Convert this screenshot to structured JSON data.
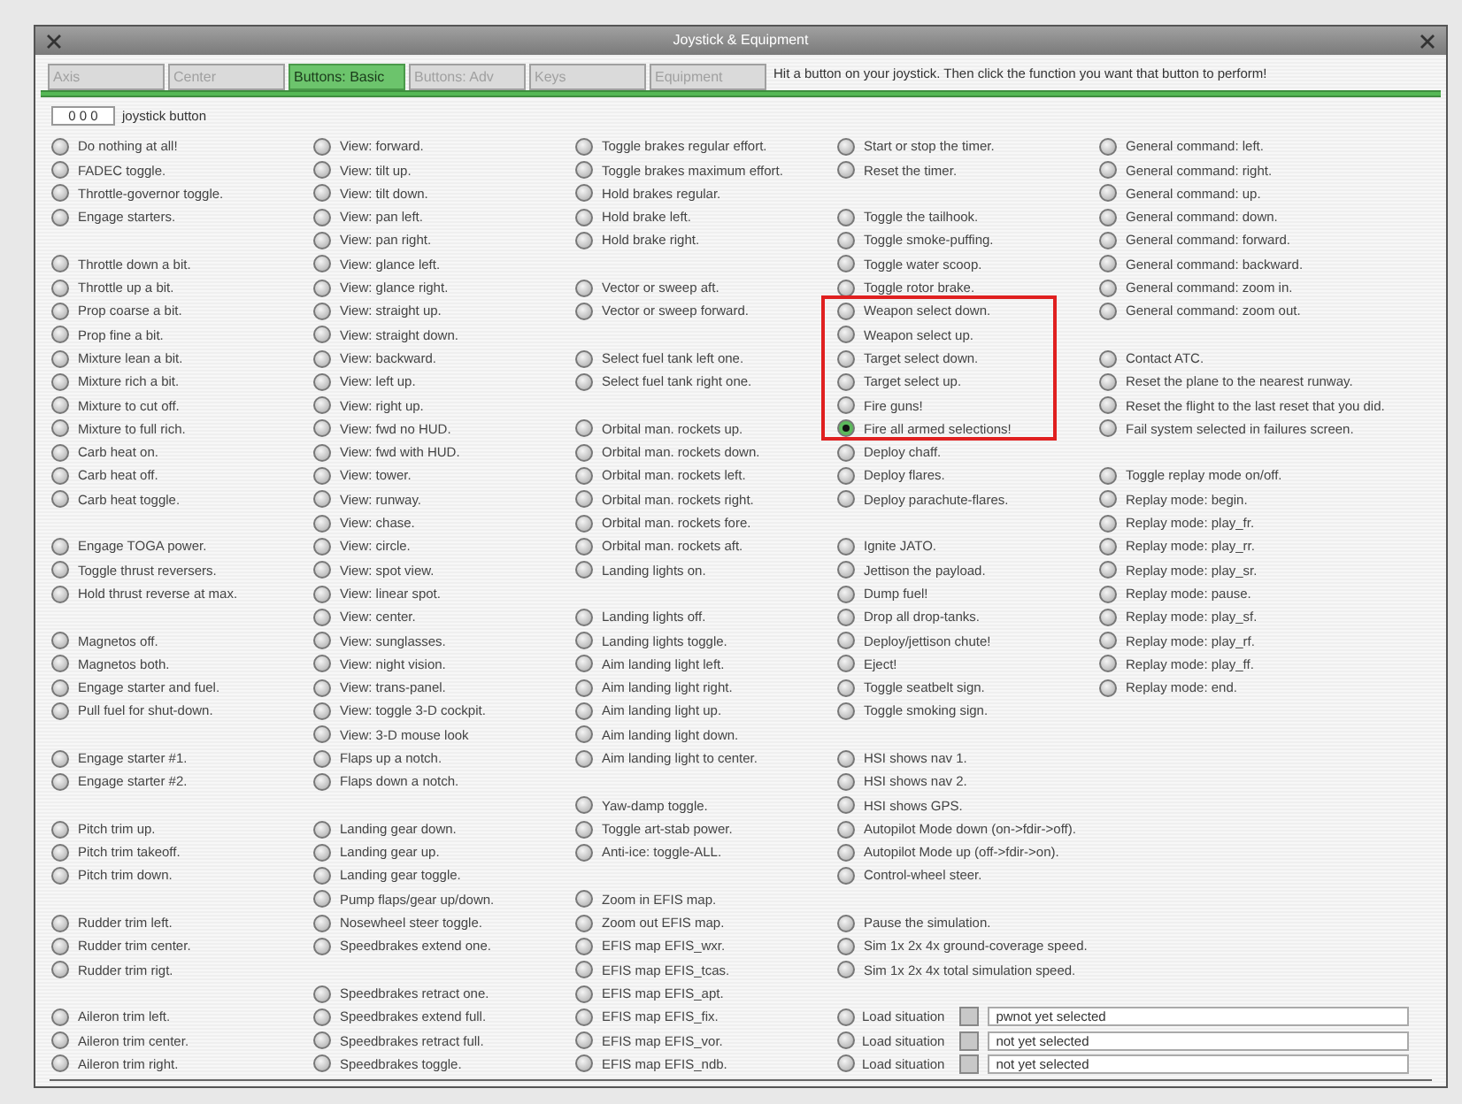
{
  "window": {
    "title": "Joystick & Equipment"
  },
  "tabs": [
    {
      "label": "Axis",
      "selected": false
    },
    {
      "label": "Center",
      "selected": false
    },
    {
      "label": "Buttons: Basic",
      "selected": true
    },
    {
      "label": "Buttons: Adv",
      "selected": false
    },
    {
      "label": "Keys",
      "selected": false
    },
    {
      "label": "Equipment",
      "selected": false
    }
  ],
  "hint": "Hit a button on your joystick. Then click the function you want that button to perform!",
  "joystick_button": {
    "value": "0 0 0",
    "label": "joystick button"
  },
  "columns": [
    {
      "groups": [
        {
          "items": [
            {
              "label": "Do nothing at all!",
              "selected": false
            },
            {
              "label": "FADEC toggle.",
              "selected": false
            },
            {
              "label": "Throttle-governor toggle.",
              "selected": false
            },
            {
              "label": "Engage starters.",
              "selected": false
            }
          ]
        },
        {
          "items": [
            {
              "label": "Throttle down a bit.",
              "selected": false
            },
            {
              "label": "Throttle up a bit.",
              "selected": false
            },
            {
              "label": "Prop coarse a bit.",
              "selected": false
            },
            {
              "label": "Prop fine a bit.",
              "selected": false
            },
            {
              "label": "Mixture lean a bit.",
              "selected": false
            },
            {
              "label": "Mixture rich a bit.",
              "selected": false
            },
            {
              "label": "Mixture to cut off.",
              "selected": false
            },
            {
              "label": "Mixture to full rich.",
              "selected": false
            },
            {
              "label": "Carb heat on.",
              "selected": false
            },
            {
              "label": "Carb heat off.",
              "selected": false
            },
            {
              "label": "Carb heat toggle.",
              "selected": false
            }
          ]
        },
        {
          "items": [
            {
              "label": "Engage TOGA power.",
              "selected": false
            },
            {
              "label": "Toggle thrust reversers.",
              "selected": false
            },
            {
              "label": "Hold thrust reverse at max.",
              "selected": false
            }
          ]
        },
        {
          "items": [
            {
              "label": "Magnetos off.",
              "selected": false
            },
            {
              "label": "Magnetos both.",
              "selected": false
            },
            {
              "label": "Engage starter and fuel.",
              "selected": false
            },
            {
              "label": "Pull fuel for shut-down.",
              "selected": false
            }
          ]
        },
        {
          "items": [
            {
              "label": "Engage starter #1.",
              "selected": false
            },
            {
              "label": "Engage starter #2.",
              "selected": false
            }
          ]
        },
        {
          "items": [
            {
              "label": "Pitch trim up.",
              "selected": false
            },
            {
              "label": "Pitch trim takeoff.",
              "selected": false
            },
            {
              "label": "Pitch trim down.",
              "selected": false
            }
          ]
        },
        {
          "items": [
            {
              "label": "Rudder trim left.",
              "selected": false
            },
            {
              "label": "Rudder trim center.",
              "selected": false
            },
            {
              "label": "Rudder trim rigt.",
              "selected": false
            }
          ]
        },
        {
          "items": [
            {
              "label": "Aileron trim left.",
              "selected": false
            },
            {
              "label": "Aileron trim center.",
              "selected": false
            },
            {
              "label": "Aileron trim right.",
              "selected": false
            }
          ]
        }
      ]
    },
    {
      "groups": [
        {
          "items": [
            {
              "label": "View: forward.",
              "selected": false
            },
            {
              "label": "View: tilt up.",
              "selected": false
            },
            {
              "label": "View: tilt down.",
              "selected": false
            },
            {
              "label": "View: pan left.",
              "selected": false
            },
            {
              "label": "View: pan right.",
              "selected": false
            },
            {
              "label": "View: glance left.",
              "selected": false
            },
            {
              "label": "View: glance right.",
              "selected": false
            },
            {
              "label": "View: straight up.",
              "selected": false
            },
            {
              "label": "View: straight down.",
              "selected": false
            },
            {
              "label": "View: backward.",
              "selected": false
            },
            {
              "label": "View: left up.",
              "selected": false
            },
            {
              "label": "View: right up.",
              "selected": false
            },
            {
              "label": "View: fwd no HUD.",
              "selected": false
            },
            {
              "label": "View: fwd with HUD.",
              "selected": false
            },
            {
              "label": "View: tower.",
              "selected": false
            },
            {
              "label": "View: runway.",
              "selected": false
            },
            {
              "label": "View: chase.",
              "selected": false
            },
            {
              "label": "View: circle.",
              "selected": false
            },
            {
              "label": "View: spot view.",
              "selected": false
            },
            {
              "label": "View: linear spot.",
              "selected": false
            },
            {
              "label": "View: center.",
              "selected": false
            },
            {
              "label": "View: sunglasses.",
              "selected": false
            },
            {
              "label": "View: night vision.",
              "selected": false
            },
            {
              "label": "View: trans-panel.",
              "selected": false
            },
            {
              "label": "View: toggle 3-D cockpit.",
              "selected": false
            },
            {
              "label": "View: 3-D mouse look",
              "selected": false
            },
            {
              "label": "Flaps up a notch.",
              "selected": false
            },
            {
              "label": "Flaps down a notch.",
              "selected": false
            }
          ]
        },
        {
          "items": [
            {
              "label": "Landing gear down.",
              "selected": false
            },
            {
              "label": "Landing gear up.",
              "selected": false
            },
            {
              "label": "Landing gear toggle.",
              "selected": false
            },
            {
              "label": "Pump flaps/gear up/down.",
              "selected": false
            },
            {
              "label": "Nosewheel steer toggle.",
              "selected": false
            },
            {
              "label": "Speedbrakes extend one.",
              "selected": false
            }
          ]
        },
        {
          "items": [
            {
              "label": "Speedbrakes retract one.",
              "selected": false
            },
            {
              "label": "Speedbrakes extend full.",
              "selected": false
            },
            {
              "label": "Speedbrakes retract full.",
              "selected": false
            },
            {
              "label": "Speedbrakes toggle.",
              "selected": false
            }
          ]
        }
      ]
    },
    {
      "groups": [
        {
          "items": [
            {
              "label": "Toggle brakes regular effort.",
              "selected": false
            },
            {
              "label": "Toggle brakes maximum effort.",
              "selected": false
            },
            {
              "label": "Hold brakes regular.",
              "selected": false
            },
            {
              "label": "Hold brake left.",
              "selected": false
            },
            {
              "label": "Hold brake right.",
              "selected": false
            }
          ]
        },
        {
          "items": [
            {
              "label": "Vector or sweep aft.",
              "selected": false
            },
            {
              "label": "Vector or sweep forward.",
              "selected": false
            }
          ]
        },
        {
          "items": [
            {
              "label": "Select fuel tank left one.",
              "selected": false
            },
            {
              "label": "Select fuel tank right one.",
              "selected": false
            }
          ]
        },
        {
          "items": [
            {
              "label": "Orbital man. rockets up.",
              "selected": false
            },
            {
              "label": "Orbital man. rockets down.",
              "selected": false
            },
            {
              "label": "Orbital man. rockets left.",
              "selected": false
            },
            {
              "label": "Orbital man. rockets right.",
              "selected": false
            },
            {
              "label": "Orbital man. rockets fore.",
              "selected": false
            },
            {
              "label": "Orbital man. rockets aft.",
              "selected": false
            },
            {
              "label": "Landing lights on.",
              "selected": false
            }
          ]
        },
        {
          "items": [
            {
              "label": "Landing lights off.",
              "selected": false
            },
            {
              "label": "Landing lights toggle.",
              "selected": false
            },
            {
              "label": "Aim landing light left.",
              "selected": false
            },
            {
              "label": "Aim landing light right.",
              "selected": false
            },
            {
              "label": "Aim landing light up.",
              "selected": false
            },
            {
              "label": "Aim landing light down.",
              "selected": false
            },
            {
              "label": "Aim landing light to center.",
              "selected": false
            }
          ]
        },
        {
          "items": [
            {
              "label": "Yaw-damp toggle.",
              "selected": false
            },
            {
              "label": "Toggle art-stab power.",
              "selected": false
            },
            {
              "label": "Anti-ice: toggle-ALL.",
              "selected": false
            }
          ]
        },
        {
          "items": [
            {
              "label": "Zoom in EFIS map.",
              "selected": false
            },
            {
              "label": "Zoom out EFIS map.",
              "selected": false
            },
            {
              "label": "EFIS map EFIS_wxr.",
              "selected": false
            },
            {
              "label": "EFIS map EFIS_tcas.",
              "selected": false
            },
            {
              "label": "EFIS map EFIS_apt.",
              "selected": false
            },
            {
              "label": "EFIS map EFIS_fix.",
              "selected": false
            },
            {
              "label": "EFIS map EFIS_vor.",
              "selected": false
            },
            {
              "label": "EFIS map EFIS_ndb.",
              "selected": false
            }
          ]
        }
      ]
    },
    {
      "groups": [
        {
          "items": [
            {
              "label": "Start or stop the timer.",
              "selected": false
            },
            {
              "label": "Reset the timer.",
              "selected": false
            }
          ]
        },
        {
          "items": [
            {
              "label": "Toggle the tailhook.",
              "selected": false
            },
            {
              "label": "Toggle smoke-puffing.",
              "selected": false
            },
            {
              "label": "Toggle water scoop.",
              "selected": false
            },
            {
              "label": "Toggle rotor brake.",
              "selected": false
            },
            {
              "label": "Weapon select down.",
              "selected": false
            },
            {
              "label": "Weapon select up.",
              "selected": false
            },
            {
              "label": "Target select down.",
              "selected": false
            },
            {
              "label": "Target select up.",
              "selected": false
            },
            {
              "label": "Fire guns!",
              "selected": false
            },
            {
              "label": "Fire all armed selections!",
              "selected": true
            },
            {
              "label": "Deploy chaff.",
              "selected": false
            },
            {
              "label": "Deploy flares.",
              "selected": false
            },
            {
              "label": "Deploy parachute-flares.",
              "selected": false
            }
          ]
        },
        {
          "items": [
            {
              "label": "Ignite JATO.",
              "selected": false
            },
            {
              "label": "Jettison the payload.",
              "selected": false
            },
            {
              "label": "Dump fuel!",
              "selected": false
            },
            {
              "label": "Drop all drop-tanks.",
              "selected": false
            },
            {
              "label": "Deploy/jettison chute!",
              "selected": false
            },
            {
              "label": "Eject!",
              "selected": false
            },
            {
              "label": "Toggle seatbelt sign.",
              "selected": false
            },
            {
              "label": "Toggle smoking sign.",
              "selected": false
            }
          ]
        },
        {
          "items": [
            {
              "label": "HSI shows nav 1.",
              "selected": false
            },
            {
              "label": "HSI shows nav 2.",
              "selected": false
            },
            {
              "label": "HSI shows GPS.",
              "selected": false
            },
            {
              "label": "Autopilot Mode down (on->fdir->off).",
              "selected": false
            },
            {
              "label": "Autopilot Mode up (off->fdir->on).",
              "selected": false
            },
            {
              "label": "Control-wheel steer.",
              "selected": false
            }
          ]
        },
        {
          "items": [
            {
              "label": "Pause the simulation.",
              "selected": false
            },
            {
              "label": "Sim 1x 2x 4x ground-coverage speed.",
              "selected": false
            },
            {
              "label": "Sim 1x 2x 4x total simulation speed.",
              "selected": false
            }
          ]
        },
        {
          "items": [
            {
              "kind": "load",
              "label": "Load situation",
              "selected": false,
              "checked": false,
              "value": "pwnot yet selected"
            },
            {
              "kind": "load",
              "label": "Load situation",
              "selected": false,
              "checked": false,
              "value": "not yet selected"
            },
            {
              "kind": "load",
              "label": "Load situation",
              "selected": false,
              "checked": false,
              "value": "not yet selected"
            }
          ]
        }
      ]
    },
    {
      "groups": [
        {
          "items": [
            {
              "label": "General command: left.",
              "selected": false
            },
            {
              "label": "General command: right.",
              "selected": false
            },
            {
              "label": "General command: up.",
              "selected": false
            },
            {
              "label": "General command: down.",
              "selected": false
            },
            {
              "label": "General command: forward.",
              "selected": false
            },
            {
              "label": "General command: backward.",
              "selected": false
            },
            {
              "label": "General command: zoom in.",
              "selected": false
            },
            {
              "label": "General command: zoom out.",
              "selected": false
            }
          ]
        },
        {
          "items": [
            {
              "label": "Contact ATC.",
              "selected": false
            },
            {
              "label": "Reset the plane to the nearest runway.",
              "selected": false
            },
            {
              "label": "Reset the flight to the last reset that you did.",
              "selected": false
            },
            {
              "label": "Fail system selected in failures screen.",
              "selected": false
            }
          ]
        },
        {
          "items": [
            {
              "label": "Toggle replay mode on/off.",
              "selected": false
            },
            {
              "label": "Replay mode: begin.",
              "selected": false
            },
            {
              "label": "Replay mode: play_fr.",
              "selected": false
            },
            {
              "label": "Replay mode: play_rr.",
              "selected": false
            },
            {
              "label": "Replay mode: play_sr.",
              "selected": false
            },
            {
              "label": "Replay mode: pause.",
              "selected": false
            },
            {
              "label": "Replay mode: play_sf.",
              "selected": false
            },
            {
              "label": "Replay mode: play_rf.",
              "selected": false
            },
            {
              "label": "Replay mode: play_ff.",
              "selected": false
            },
            {
              "label": "Replay mode: end.",
              "selected": false
            }
          ]
        }
      ]
    }
  ]
}
